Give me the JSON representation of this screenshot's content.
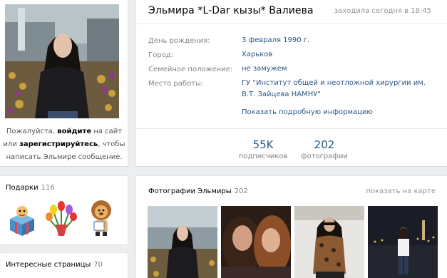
{
  "profile": {
    "name": "Эльмира *L-Dar кызы* Валиева",
    "last_seen": "заходила сегодня в 18:45",
    "details": [
      {
        "label": "День рождения:",
        "value": "3 февраля 1990 г."
      },
      {
        "label": "Город:",
        "value": "Харьков"
      },
      {
        "label": "Семейное положение:",
        "value": "не замужем"
      },
      {
        "label": "Место работы:",
        "value": "ГУ \"Институт общей и неотложной хирургии им. В.Т. Зайцева НАМНУ\""
      }
    ],
    "show_more": "Показать подробную информацию",
    "counters": [
      {
        "number": "55K",
        "label": "подписчиков"
      },
      {
        "number": "202",
        "label": "фотографии"
      }
    ]
  },
  "login_prompt": {
    "part1": "Пожалуйста, ",
    "login": "войдите",
    "part2": " на сайт или ",
    "register": "зарегистрируйтесь",
    "part3": ", чтобы написать Эльмире сообщение."
  },
  "gifts": {
    "title": "Подарки",
    "count": "116",
    "icons": [
      "gift-box-icon",
      "tulip-bouquet-icon",
      "lion-mascot-icon"
    ]
  },
  "interesting": {
    "title": "Интересные страницы",
    "count": "70"
  },
  "photos": {
    "title": "Фотографии Эльмиры",
    "count": "202",
    "map_link": "показать на карте"
  },
  "colors": {
    "accent": "#2a5885",
    "background": "#edeef0",
    "muted": "#828282"
  }
}
